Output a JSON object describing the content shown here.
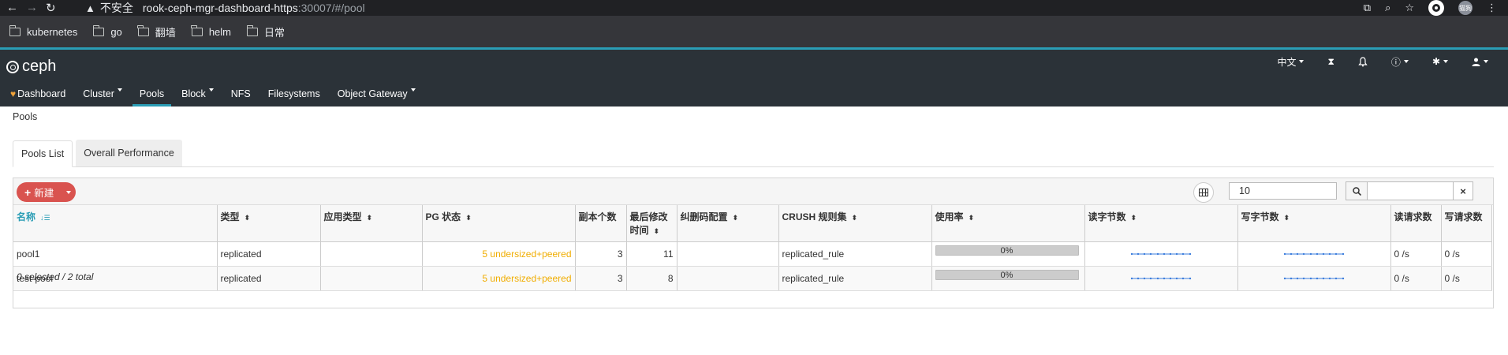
{
  "browser": {
    "insecure_label": "不安全",
    "url_host": "rook-ceph-mgr-dashboard-https",
    "url_rest": ":30007/#/pool",
    "avatar_text": "猫狗"
  },
  "bookmarks": [
    "kubernetes",
    "go",
    "翻墙",
    "helm",
    "日常"
  ],
  "app": {
    "logo_text": "ceph",
    "language": "中文"
  },
  "nav": {
    "dashboard": "Dashboard",
    "cluster": "Cluster",
    "pools": "Pools",
    "block": "Block",
    "nfs": "NFS",
    "filesystems": "Filesystems",
    "object_gateway": "Object Gateway"
  },
  "breadcrumb": "Pools",
  "tabs": {
    "pools_list": "Pools List",
    "overall_performance": "Overall Performance"
  },
  "toolbar": {
    "new_label": "新建",
    "page_size": "10",
    "search_value": ""
  },
  "table": {
    "headers": {
      "name": "名称",
      "type": "类型",
      "app_type": "应用类型",
      "pg_status": "PG 状态",
      "replica": "副本个数",
      "last_change": "最后修改",
      "last_change_2": "时间",
      "ec_profile": "纠删码配置",
      "crush": "CRUSH 规则集",
      "usage": "使用率",
      "read_bytes": "读字节数",
      "write_bytes": "写字节数",
      "read_ops": "读请求数",
      "write_ops": "写请求数"
    },
    "rows": [
      {
        "name": "pool1",
        "type": "replicated",
        "app_type": "",
        "pg_status": "5 undersized+peered",
        "replica": "3",
        "last_change": "11",
        "ec_profile": "",
        "crush": "replicated_rule",
        "usage": "0%",
        "read_ops": "0 /s",
        "write_ops": "0 /s"
      },
      {
        "name": "test-pool",
        "type": "replicated",
        "app_type": "",
        "pg_status": "5 undersized+peered",
        "replica": "3",
        "last_change": "8",
        "ec_profile": "",
        "crush": "replicated_rule",
        "usage": "0%",
        "read_ops": "0 /s",
        "write_ops": "0 /s"
      }
    ],
    "footer": "0 selected / 2 total"
  },
  "colors": {
    "accent": "#2a9db5",
    "new_button": "#d9534f",
    "warning": "#f0ad00",
    "masthead": "#2b3238"
  }
}
